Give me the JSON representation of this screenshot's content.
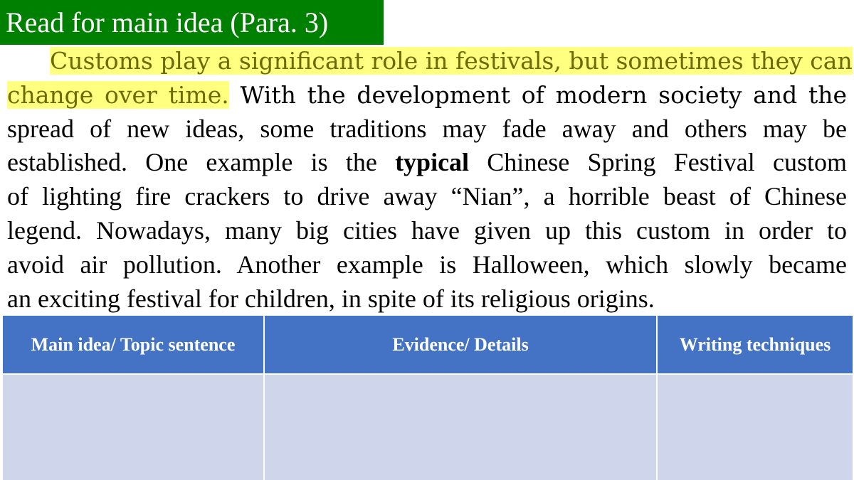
{
  "slide": {
    "title": "Read for main idea (Para. 3)"
  },
  "paragraph": {
    "highlight_1": "Customs play a significant role in festivals, but sometimes they can",
    "highlight_2": "change over time.",
    "line_2_rest": " With the development of modern society and the",
    "line_3": "spread of new ideas, some traditions may fade away and others may be",
    "line_4_a": "established. One example is the ",
    "line_4_bold": "typical",
    "line_4_b": " Chinese Spring Festival custom",
    "line_5": "of lighting fire crackers to drive away “Nian”, a horrible beast of Chinese",
    "line_6": "legend. Nowadays, many big cities have given up this custom in order to",
    "line_7": "avoid air pollution. Another example is Halloween, which slowly became",
    "line_8": "an exciting festival for children, in spite of its religious origins.",
    "highlight_color": "#ffff80"
  },
  "table": {
    "headers": [
      "Main idea/ Topic sentence",
      "Evidence/ Details",
      "Writing techniques"
    ],
    "rows": [
      [
        "",
        "",
        ""
      ]
    ],
    "header_color": "#4472c4",
    "cell_color": "#cfd5ea"
  }
}
